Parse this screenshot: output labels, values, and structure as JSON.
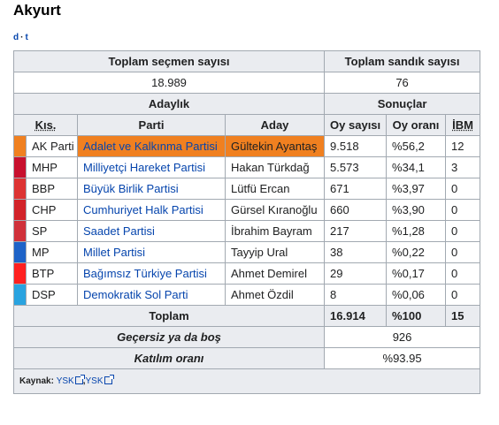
{
  "title": "Akyurt",
  "nav": {
    "d": "d",
    "sep": "·",
    "t": "t"
  },
  "summary": {
    "voters_label": "Toplam seçmen sayısı",
    "boxes_label": "Toplam sandık sayısı",
    "voters": "18.989",
    "boxes": "76"
  },
  "headers": {
    "candidacy": "Adaylık",
    "results": "Sonuçlar",
    "abbr": "Kıs.",
    "party": "Parti",
    "candidate": "Aday",
    "votes": "Oy sayısı",
    "percent": "Oy oranı",
    "ibm": "İBM"
  },
  "rows": [
    {
      "color": "#f08020",
      "abbr": "AK Parti",
      "party": "Adalet ve Kalkınma Partisi",
      "candidate": "Gültekin Ayantaş",
      "votes": "9.518",
      "percent": "%56,2",
      "ibm": "12",
      "highlight": true
    },
    {
      "color": "#c8102e",
      "abbr": "MHP",
      "party": "Milliyetçi Hareket Partisi",
      "candidate": "Hakan Türkdağ",
      "votes": "5.573",
      "percent": "%34,1",
      "ibm": "3"
    },
    {
      "color": "#dd3333",
      "abbr": "BBP",
      "party": "Büyük Birlik Partisi",
      "candidate": "Lütfü Ercan",
      "votes": "671",
      "percent": "%3,97",
      "ibm": "0"
    },
    {
      "color": "#d2232a",
      "abbr": "CHP",
      "party": "Cumhuriyet Halk Partisi",
      "candidate": "Gürsel Kıranoğlu",
      "votes": "660",
      "percent": "%3,90",
      "ibm": "0"
    },
    {
      "color": "#d0313b",
      "abbr": "SP",
      "party": "Saadet Partisi",
      "candidate": "İbrahim Bayram",
      "votes": "217",
      "percent": "%1,28",
      "ibm": "0"
    },
    {
      "color": "#1e63c8",
      "abbr": "MP",
      "party": "Millet Partisi",
      "candidate": "Tayyip Ural",
      "votes": "38",
      "percent": "%0,22",
      "ibm": "0"
    },
    {
      "color": "#ff2020",
      "abbr": "BTP",
      "party": "Bağımsız Türkiye Partisi",
      "candidate": "Ahmet Demirel",
      "votes": "29",
      "percent": "%0,17",
      "ibm": "0"
    },
    {
      "color": "#29a3e0",
      "abbr": "DSP",
      "party": "Demokratik Sol Parti",
      "candidate": "Ahmet Özdil",
      "votes": "8",
      "percent": "%0,06",
      "ibm": "0"
    }
  ],
  "totals": {
    "label": "Toplam",
    "votes": "16.914",
    "percent": "%100",
    "ibm": "15",
    "invalid_label": "Geçersiz ya da boş",
    "invalid": "926",
    "turnout_label": "Katılım oranı",
    "turnout": "%93.95"
  },
  "source": {
    "label": "Kaynak:",
    "link1": "YSK",
    "sep": ",",
    "link2": "YSK"
  }
}
